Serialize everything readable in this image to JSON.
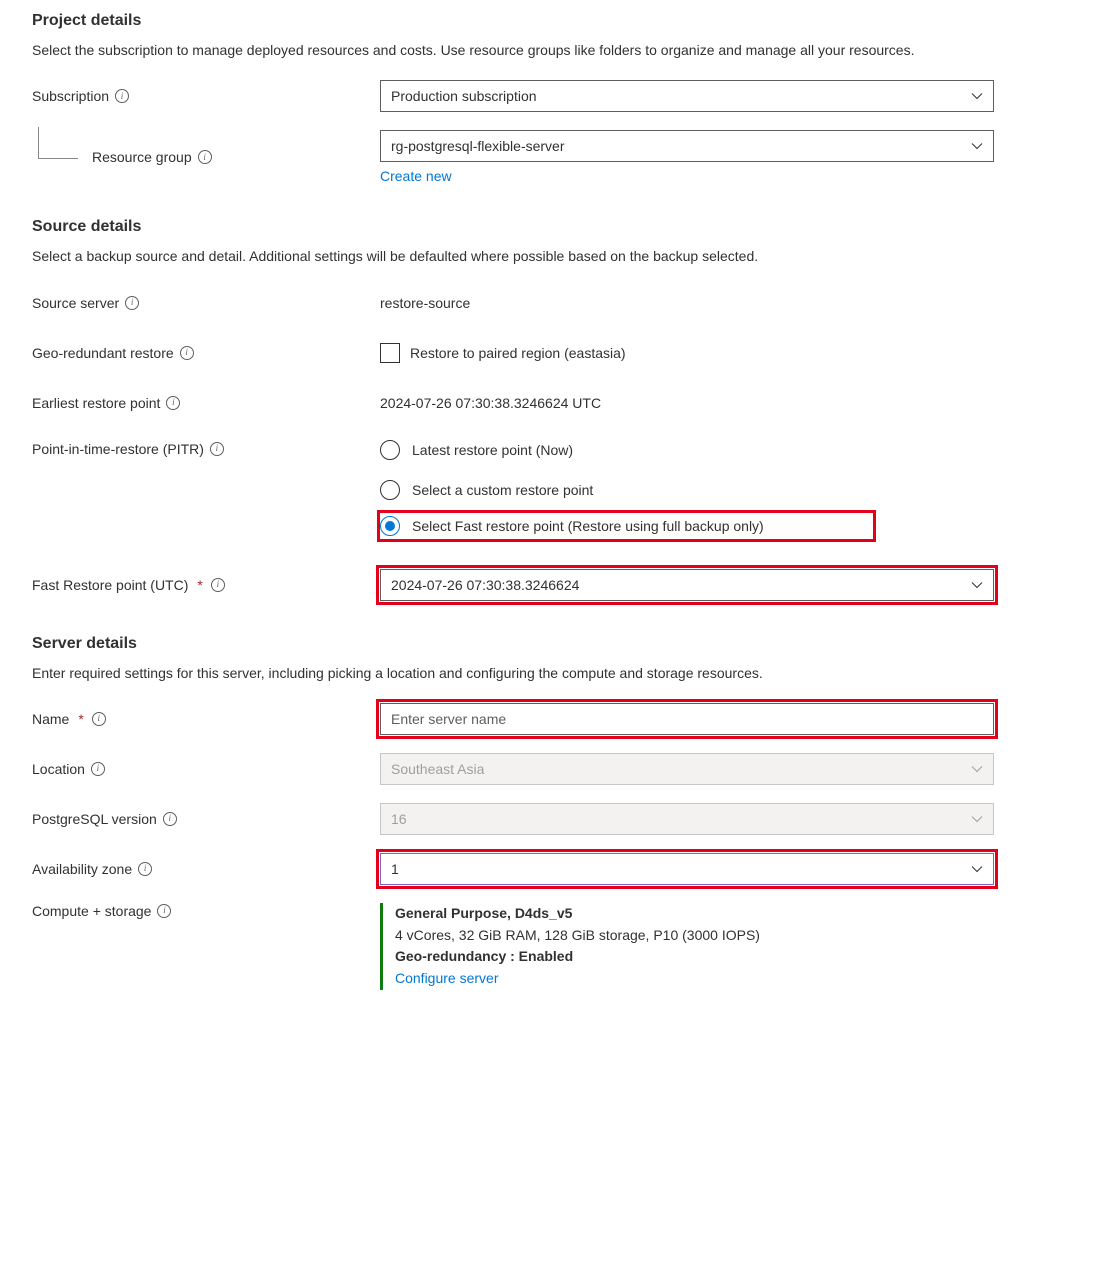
{
  "project": {
    "heading": "Project details",
    "desc": "Select the subscription to manage deployed resources and costs. Use resource groups like folders to organize and manage all your resources.",
    "subscription_label": "Subscription",
    "subscription_value": "Production subscription",
    "resource_group_label": "Resource group",
    "resource_group_value": "rg-postgresql-flexible-server",
    "create_new": "Create new"
  },
  "source": {
    "heading": "Source details",
    "desc": "Select a backup source and detail. Additional settings will be defaulted where possible based on the backup selected.",
    "source_server_label": "Source server",
    "source_server_value": "restore-source",
    "geo_label": "Geo-redundant restore",
    "geo_checkbox_label": "Restore to paired region (eastasia)",
    "earliest_label": "Earliest restore point",
    "earliest_value": "2024-07-26 07:30:38.3246624 UTC",
    "pitr_label": "Point-in-time-restore (PITR)",
    "pitr_opts": {
      "latest": "Latest restore point (Now)",
      "custom": "Select a custom restore point",
      "fast": "Select Fast restore point (Restore using full backup only)"
    },
    "fast_label": "Fast Restore point (UTC)",
    "fast_value": "2024-07-26 07:30:38.3246624"
  },
  "server": {
    "heading": "Server details",
    "desc": "Enter required settings for this server, including picking a location and configuring the compute and storage resources.",
    "name_label": "Name",
    "name_placeholder": "Enter server name",
    "location_label": "Location",
    "location_value": "Southeast Asia",
    "pg_label": "PostgreSQL version",
    "pg_value": "16",
    "az_label": "Availability zone",
    "az_value": "1",
    "compute_label": "Compute + storage",
    "compute": {
      "sku": "General Purpose, D4ds_v5",
      "spec": "4 vCores, 32 GiB RAM, 128 GiB storage, P10 (3000 IOPS)",
      "geo": "Geo-redundancy : Enabled",
      "configure": "Configure server"
    }
  }
}
